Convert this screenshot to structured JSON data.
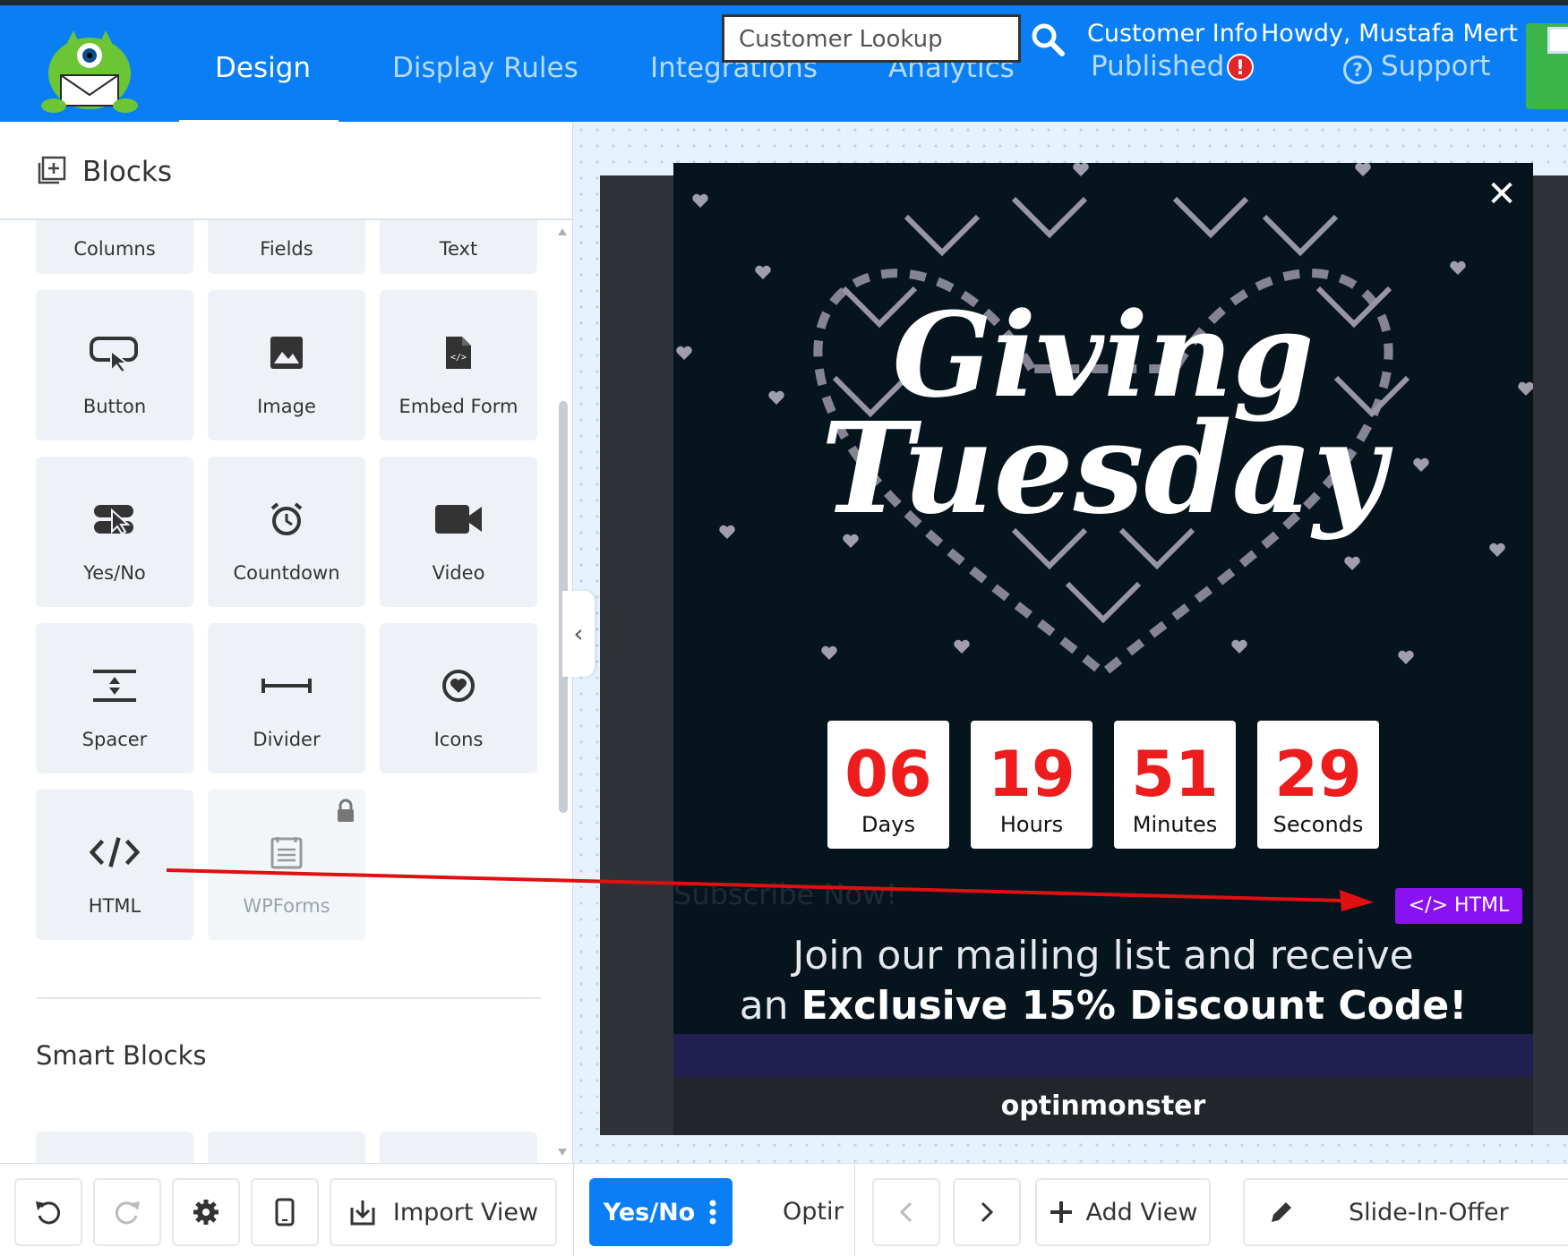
{
  "nav": {
    "tabs": [
      {
        "label": "Design",
        "active": true
      },
      {
        "label": "Display Rules"
      },
      {
        "label": "Integrations"
      },
      {
        "label": "Analytics"
      }
    ],
    "lookup_value": "Customer Lookup",
    "customer_info": "Customer Info",
    "status": "Published",
    "alert_mark": "!",
    "greeting": "Howdy, Mustafa Mert Asan",
    "support": "Support",
    "support_icon_glyph": "?"
  },
  "sidebar": {
    "title": "Blocks",
    "blocks": [
      {
        "label": "Columns",
        "icon": "columns-icon"
      },
      {
        "label": "Fields",
        "icon": "fields-icon"
      },
      {
        "label": "Text",
        "icon": "text-icon"
      },
      {
        "label": "Button",
        "icon": "cursor-click-icon"
      },
      {
        "label": "Image",
        "icon": "image-icon"
      },
      {
        "label": "Embed Form",
        "icon": "code-file-icon"
      },
      {
        "label": "Yes/No",
        "icon": "toggle-pointer-icon"
      },
      {
        "label": "Countdown",
        "icon": "alarm-clock-icon"
      },
      {
        "label": "Video",
        "icon": "video-camera-icon"
      },
      {
        "label": "Spacer",
        "icon": "spacer-icon"
      },
      {
        "label": "Divider",
        "icon": "divider-icon"
      },
      {
        "label": "Icons",
        "icon": "heart-circle-icon"
      },
      {
        "label": "HTML",
        "icon": "code-icon"
      },
      {
        "label": "WPForms",
        "icon": "form-icon",
        "locked": true
      }
    ],
    "smart_blocks_title": "Smart Blocks"
  },
  "campaign": {
    "headline_line1": "Giving",
    "headline_line2": "Tuesday",
    "countdown": [
      {
        "value": "06",
        "unit": "Days"
      },
      {
        "value": "19",
        "unit": "Hours"
      },
      {
        "value": "51",
        "unit": "Minutes"
      },
      {
        "value": "29",
        "unit": "Seconds"
      }
    ],
    "hidden_text": "Subscribe Now!",
    "html_badge": "</> HTML",
    "join_line1": "Join our mailing list and receive",
    "join_line2_prefix": "an ",
    "join_line2_bold": "Exclusive 15% Discount Code!",
    "brand": "optinmonster"
  },
  "bottom": {
    "import_view": "Import View",
    "view_button": "Yes/No",
    "optin_label": "Optin",
    "add_view": "Add View",
    "slide_in": "Slide-In-Offer"
  },
  "colors": {
    "primary": "#0a7ff5",
    "countdown_red": "#ee1c1c",
    "html_badge": "#8a12f2",
    "arrow": "#e01010",
    "status_alert": "#e3242b"
  }
}
